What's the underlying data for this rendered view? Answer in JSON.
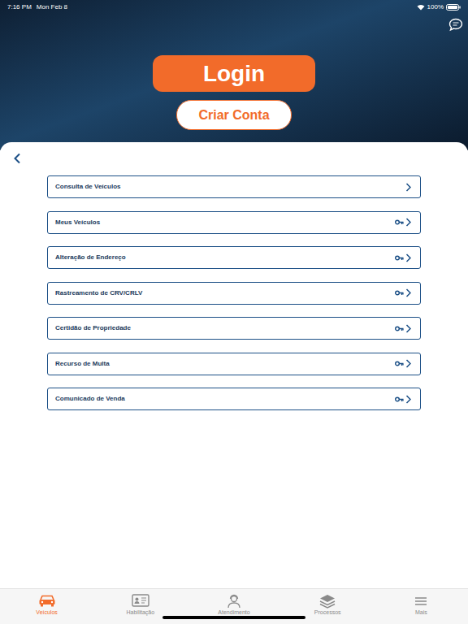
{
  "status_bar": {
    "time": "7:16 PM",
    "date": "Mon Feb 8",
    "battery": "100%"
  },
  "header": {
    "login": "Login",
    "create_account": "Criar Conta"
  },
  "menu": [
    {
      "label": "Consulta de Veículos",
      "locked": false
    },
    {
      "label": "Meus Veículos",
      "locked": true
    },
    {
      "label": "Alteração de Endereço",
      "locked": true
    },
    {
      "label": "Rastreamento de CRV/CRLV",
      "locked": true
    },
    {
      "label": "Certidão de Propriedade",
      "locked": true
    },
    {
      "label": "Recurso de Multa",
      "locked": true
    },
    {
      "label": "Comunicado de Venda",
      "locked": true
    }
  ],
  "tabs": [
    {
      "label": "Veículos",
      "selected": true
    },
    {
      "label": "Habilitação",
      "selected": false
    },
    {
      "label": "Atendimento",
      "selected": false
    },
    {
      "label": "Processos",
      "selected": false
    },
    {
      "label": "Mais",
      "selected": false
    }
  ]
}
